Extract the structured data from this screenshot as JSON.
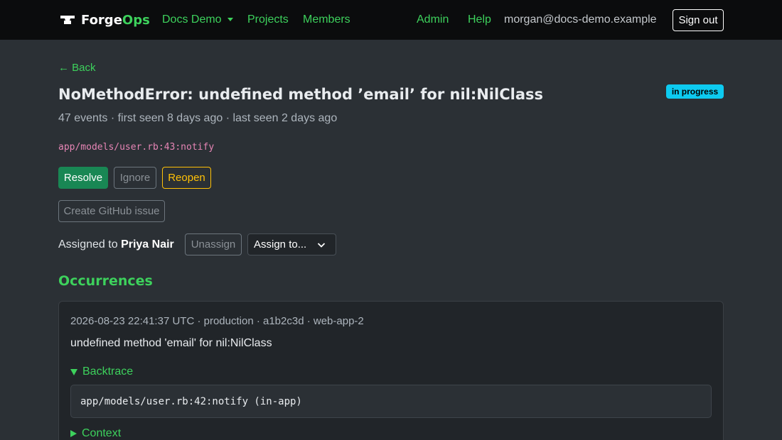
{
  "navbar": {
    "brand_part1": "Forge",
    "brand_part2": "Ops",
    "project_dropdown": "Docs Demo",
    "projects": "Projects",
    "members": "Members",
    "admin": "Admin",
    "help": "Help",
    "user_email": "morgan@docs-demo.example",
    "sign_out": "Sign out"
  },
  "issue": {
    "back": "← Back",
    "title": "NoMethodError: undefined method ’email’ for nil:NilClass",
    "status_badge": "in progress",
    "meta": "47 events · first seen 8 days ago · last seen 2 days ago",
    "location": "app/models/user.rb:43:notify",
    "actions": {
      "resolve": "Resolve",
      "ignore": "Ignore",
      "reopen": "Reopen",
      "create_github_issue": "Create GitHub issue"
    },
    "assignment": {
      "prefix": "Assigned to",
      "assignee": "Priya Nair",
      "unassign": "Unassign",
      "assign_select": "Assign to..."
    }
  },
  "occurrences": {
    "heading": "Occurrences",
    "items": [
      {
        "meta": "2026-08-23 22:41:37 UTC · production · a1b2c3d · web-app-2",
        "message": "undefined method 'email' for nil:NilClass",
        "backtrace_label": "Backtrace",
        "backtrace_lines": [
          "app/models/user.rb:42:notify (in-app)"
        ],
        "context_label": "Context"
      }
    ]
  },
  "colors": {
    "accent_green": "#3dd15c",
    "badge_info": "#0dcaf0",
    "success": "#198754",
    "warning": "#ffc107",
    "code_pink": "#e685b5"
  }
}
